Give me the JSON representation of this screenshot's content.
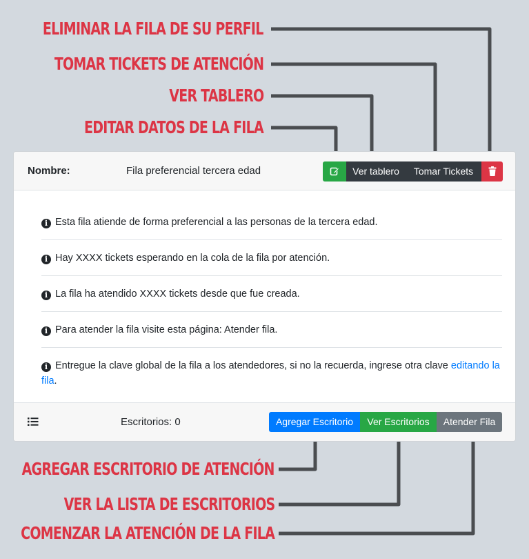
{
  "callouts": {
    "delete_row": "ELIMINAR LA FILA DE SU PERFIL",
    "take_tickets": "TOMAR TICKETS DE ATENCIÓN",
    "view_board": "VER TABLERO",
    "edit_row": "EDITAR DATOS DE LA FILA",
    "add_desk": "AGREGAR ESCRITORIO DE ATENCIÓN",
    "view_desks": "VER LA LISTA DE ESCRITORIOS",
    "start_attention": "COMENZAR LA ATENCIÓN DE LA FILA"
  },
  "header": {
    "name_label": "Nombre:",
    "name_value": "Fila preferencial tercera edad",
    "board_button": "Ver tablero",
    "tickets_button": "Tomar Tickets"
  },
  "info_items": [
    "Esta fila atiende de forma preferencial a las personas de la tercera edad.",
    "Hay XXXX tickets esperando en la cola de la fila por atención.",
    "La fila ha atendido XXXX tickets desde que fue creada.",
    "Para atender la fila visite esta página: Atender fila."
  ],
  "last_item": {
    "text": "Entregue la clave global de la fila a los atendedores, si no la recuerda, ingrese otra clave ",
    "link": "editando la fila",
    "suffix": "."
  },
  "footer": {
    "desks_label": "Escritorios: 0",
    "add_button": "Agregar Escritorio",
    "view_button": "Ver Escritorios",
    "attend_button": "Atender Fila"
  },
  "colors": {
    "callout": "#dc3545",
    "success": "#28a745",
    "dark": "#343a40",
    "danger": "#dc3545",
    "primary": "#007bff",
    "secondary": "#6c757d"
  }
}
